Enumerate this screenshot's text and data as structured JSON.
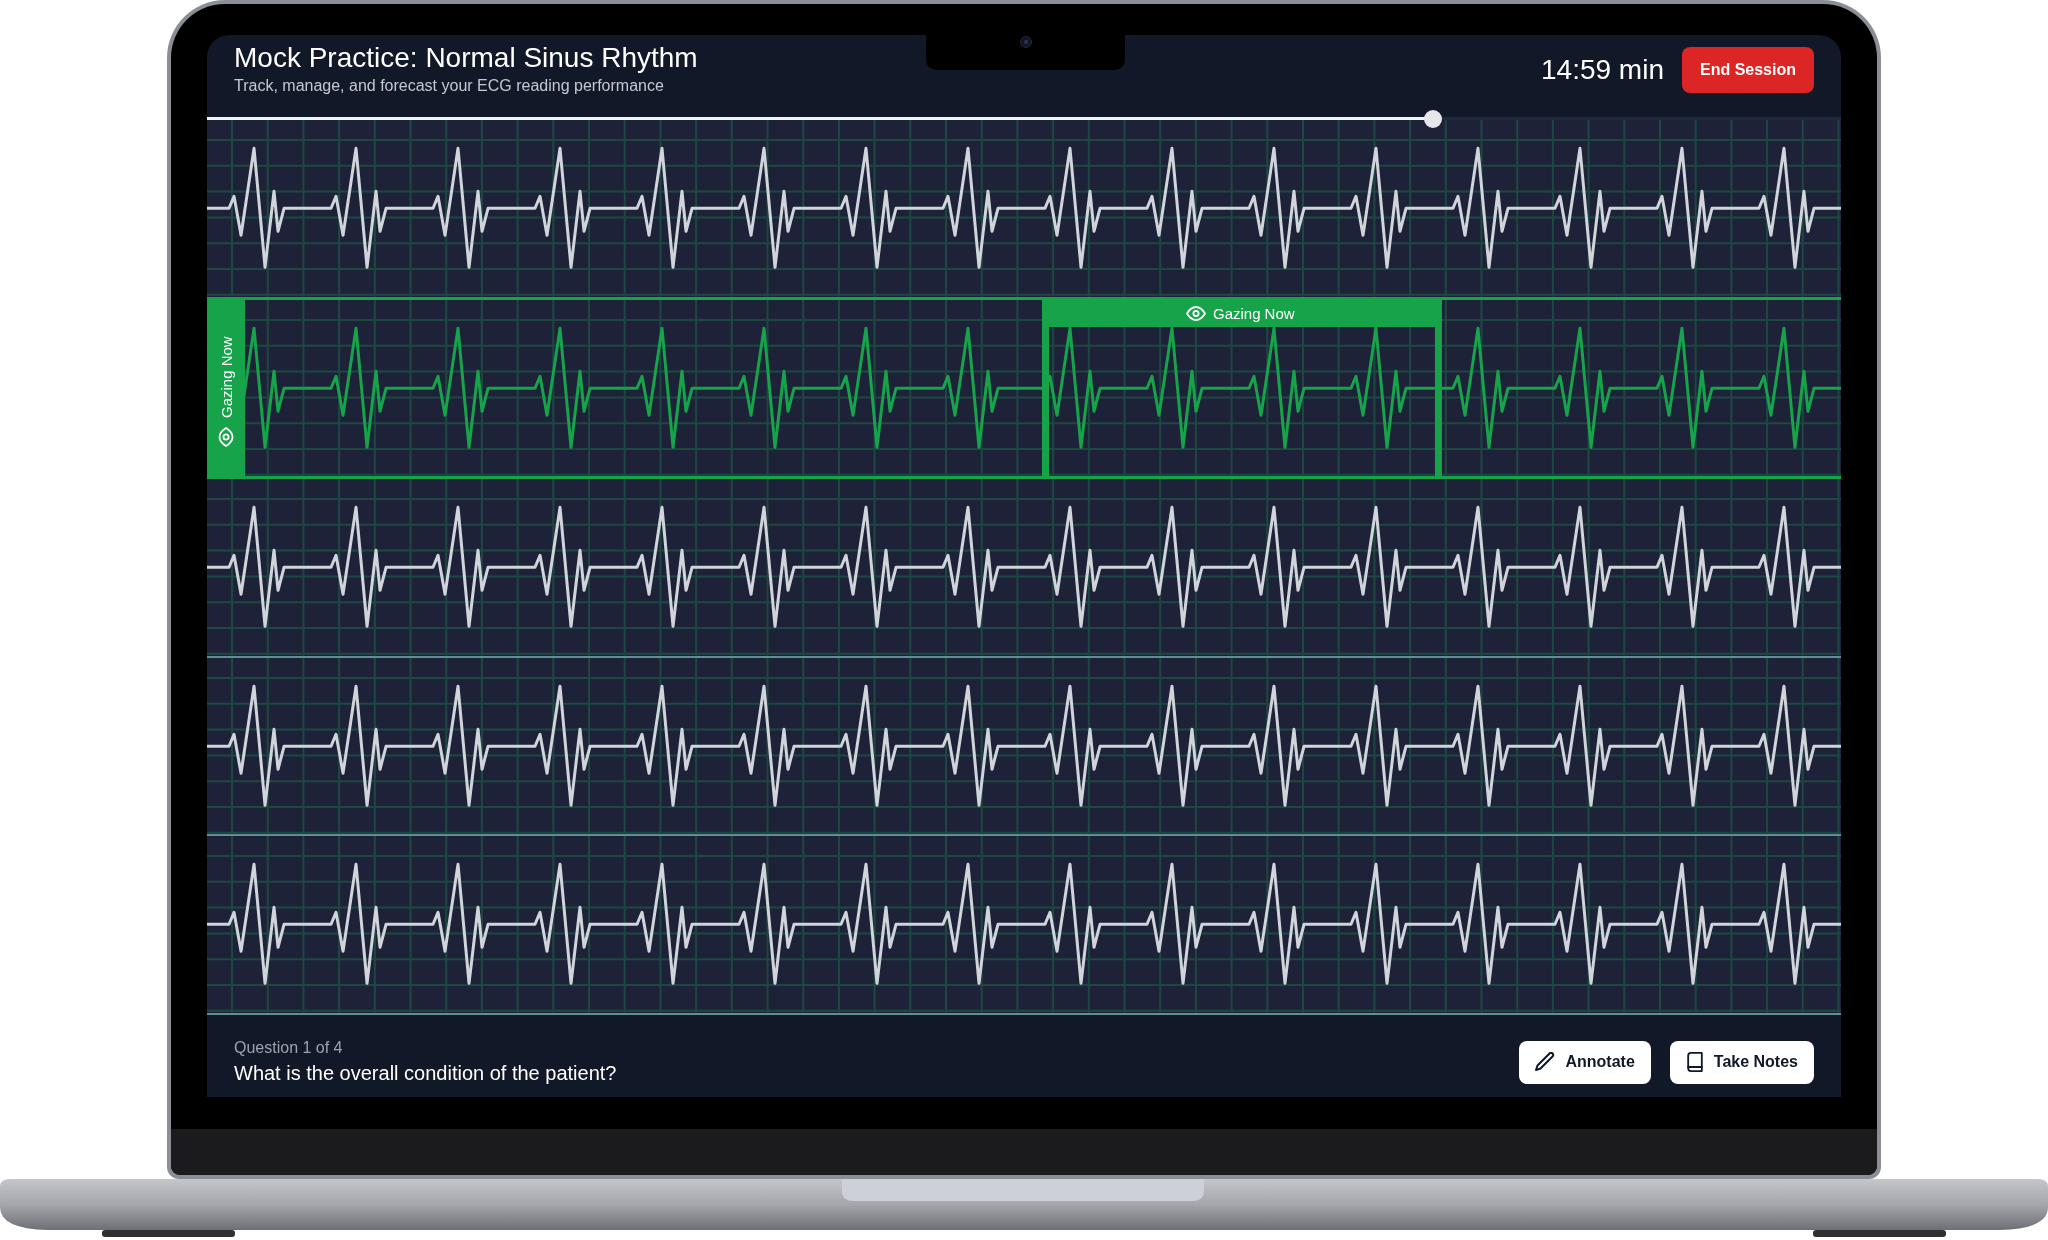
{
  "header": {
    "title": "Mock Practice: Normal Sinus Rhythm",
    "subtitle": "Track, manage, and forecast your ECG reading performance",
    "timer": "14:59 min",
    "end_button": "End Session"
  },
  "progress": {
    "level": 0.75
  },
  "ecg_strips": [
    {
      "gazed": false
    },
    {
      "gazed": true,
      "side_label": "Gazing Now",
      "gaze_box_label": "Gazing Now"
    },
    {
      "gazed": false
    },
    {
      "gazed": false
    },
    {
      "gazed": false
    }
  ],
  "question": {
    "counter": "Question 1 of 4",
    "text": "What is the overall condition of the patient?"
  },
  "actions": [
    {
      "kind": "annotate",
      "label": "Annotate"
    },
    {
      "kind": "notes",
      "label": "Take Notes"
    }
  ]
}
